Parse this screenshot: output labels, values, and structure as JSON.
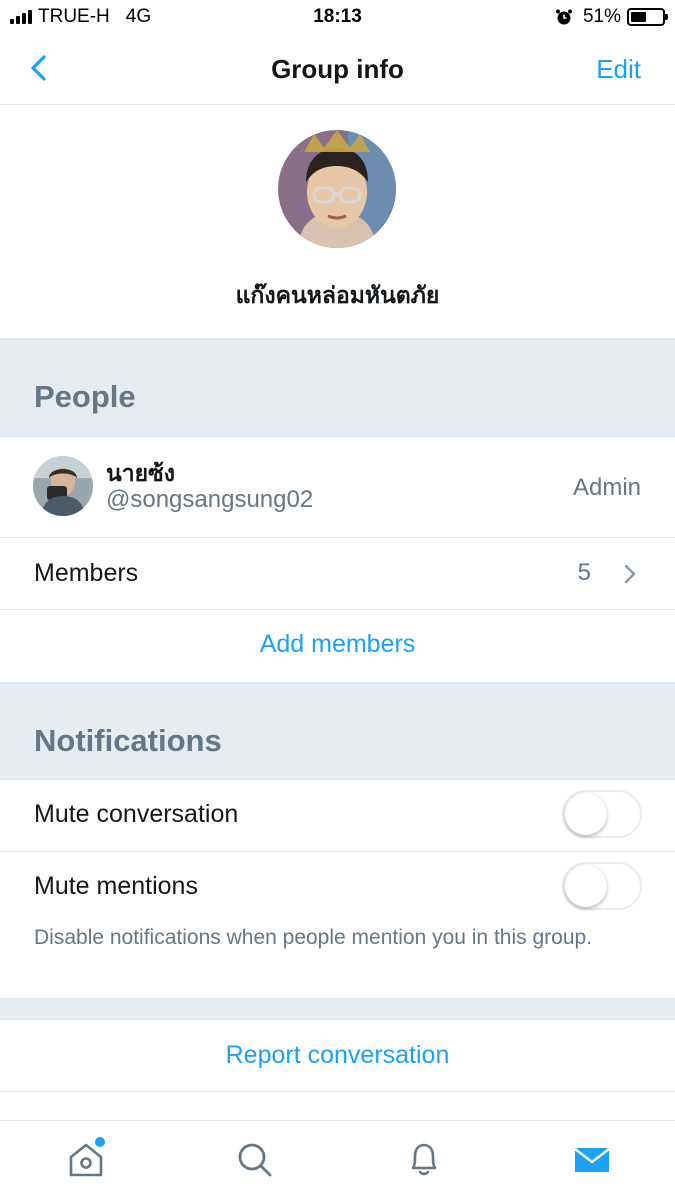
{
  "status_bar": {
    "carrier": "TRUE-H",
    "network": "4G",
    "time": "18:13",
    "battery_percent": "51%",
    "battery_level": 0.51,
    "alarm_icon": "alarm-clock-icon"
  },
  "nav": {
    "title": "Group info",
    "edit_label": "Edit",
    "back_icon": "chevron-left-icon"
  },
  "group": {
    "name": "แก๊งคนหล่อมหันตภัย"
  },
  "people_section": {
    "title": "People",
    "admin": {
      "name": "นายซ้ง",
      "handle": "@songsangsung02",
      "role": "Admin"
    },
    "members_label": "Members",
    "members_count": "5",
    "add_members_label": "Add members"
  },
  "notifications_section": {
    "title": "Notifications",
    "mute_conversation_label": "Mute conversation",
    "mute_conversation_on": false,
    "mute_mentions_label": "Mute mentions",
    "mute_mentions_on": false,
    "mute_mentions_hint": "Disable notifications when people mention you in this group."
  },
  "actions": {
    "report_label": "Report conversation"
  },
  "tab_bar": {
    "tabs": [
      "home-icon",
      "search-icon",
      "bell-icon",
      "mail-icon"
    ],
    "active_tab": "mail-icon",
    "home_has_notification": true
  },
  "colors": {
    "accent": "#1da1f2",
    "section_bg": "#e6ecf0",
    "secondary_text": "#657786",
    "danger": "#e0245e"
  }
}
